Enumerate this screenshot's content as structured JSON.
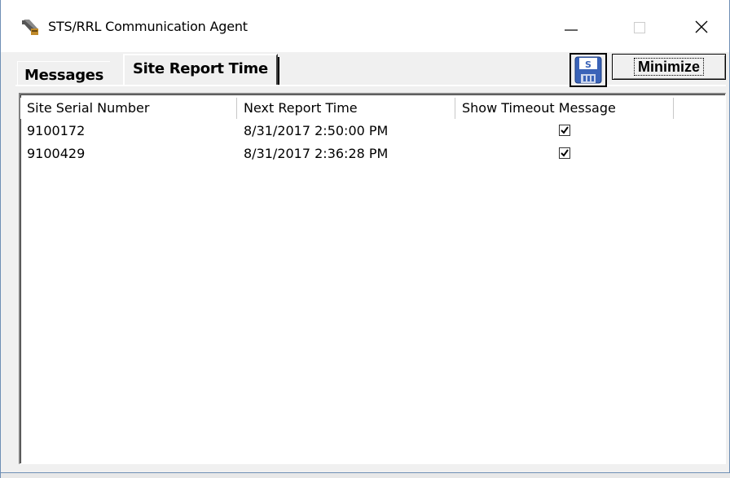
{
  "window": {
    "title": "STS/RRL Communication Agent"
  },
  "tabs": [
    {
      "label": "Messages",
      "active": false
    },
    {
      "label": "Site Report Time",
      "active": true
    }
  ],
  "toolbar": {
    "save_icon_letter": "S",
    "minimize_label": "Minimize"
  },
  "table": {
    "columns": [
      "Site Serial Number",
      "Next Report Time",
      "Show Timeout Message"
    ],
    "rows": [
      {
        "serial": "9100172",
        "next_report": "8/31/2017 2:50:00 PM",
        "show_timeout": true
      },
      {
        "serial": "9100429",
        "next_report": "8/31/2017 2:36:28 PM",
        "show_timeout": true
      }
    ]
  }
}
